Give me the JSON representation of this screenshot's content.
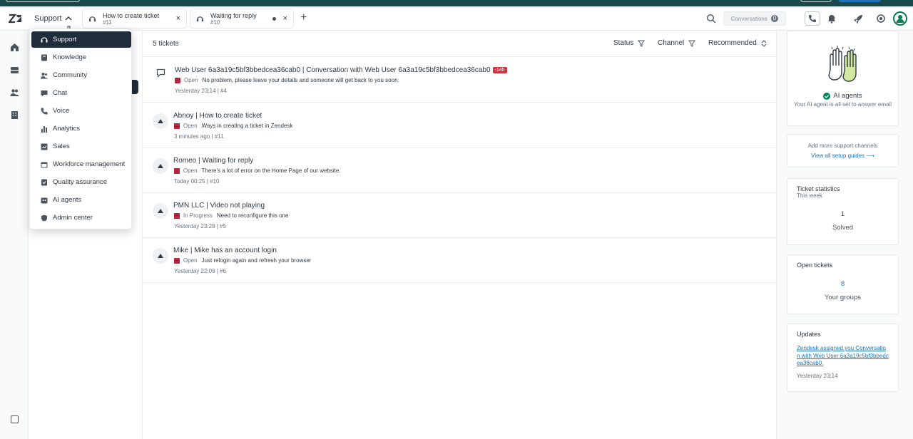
{
  "header": {
    "product_switcher_label": "Support",
    "tabs": [
      {
        "title": "How to create ticket",
        "subtitle": "#11"
      },
      {
        "title": "Waiting for reply",
        "subtitle": "#10"
      }
    ],
    "conversations_label": "Conversations",
    "conversations_count": "0"
  },
  "product_menu": {
    "items": [
      {
        "label": "Support",
        "icon": "headset-icon"
      },
      {
        "label": "Knowledge",
        "icon": "book-icon"
      },
      {
        "label": "Community",
        "icon": "people-icon"
      },
      {
        "label": "Chat",
        "icon": "chat-icon"
      },
      {
        "label": "Voice",
        "icon": "phone-icon"
      },
      {
        "label": "Analytics",
        "icon": "bar-chart-icon"
      },
      {
        "label": "Sales",
        "icon": "line-chart-icon"
      },
      {
        "label": "Workforce management",
        "icon": "calendar-icon"
      },
      {
        "label": "Quality assurance",
        "icon": "check-clipboard-icon"
      },
      {
        "label": "AI agents",
        "icon": "robot-icon"
      },
      {
        "label": "Admin center",
        "icon": "shield-icon"
      }
    ]
  },
  "list": {
    "count_label": "5 tickets",
    "filters": {
      "status": "Status",
      "channel": "Channel",
      "sort": "Recommended"
    },
    "tickets": [
      {
        "title": "Web User 6a3a19c5bf3bbedcea36cab0 | Conversation with Web User 6a3a19c5bf3bbedcea36cab0",
        "badge": "-14h",
        "status": "Open",
        "preview": "No problem, please leave your details and someone will get back to you soon.",
        "meta": "Yesterday 23:14 | #4"
      },
      {
        "title": "Abnoy | How to create ticket",
        "badge": "",
        "status": "Open",
        "preview": "Ways in creating a ticket in Zendesk",
        "meta": "3 minutes ago | #11"
      },
      {
        "title": "Romeo | Waiting for reply",
        "badge": "",
        "status": "Open",
        "preview": "There's a lot of error on the Home Page of our website.",
        "meta": "Today 00:25 | #10"
      },
      {
        "title": "PMN LLC | Video not playing",
        "badge": "",
        "status": "In Progress",
        "preview": "Need to reconfigure this one",
        "meta": "Yesterday 23:28 | #5"
      },
      {
        "title": "Mike | Mike has an account login",
        "badge": "",
        "status": "Open",
        "preview": "Just relogin again and refresh your browser",
        "meta": "Yesterday 22:09 | #6"
      }
    ]
  },
  "right": {
    "ai_card": {
      "title": "AI agents",
      "text": "Your AI agent is all set to answer email"
    },
    "channels_card": {
      "title": "Add more support channels",
      "link": "View all setup guides"
    },
    "stats_card": {
      "title": "Ticket statistics",
      "period": "This week",
      "value": "1",
      "value_label": "Solved"
    },
    "open_card": {
      "title": "Open tickets",
      "value": "8",
      "value_label": "Your groups"
    },
    "updates_card": {
      "title": "Updates",
      "link": "Zendesk assigned you Conversation with Web User 6a3a19c5bf3bbedcea36cab0.",
      "time": "Yesterday 23:14"
    }
  },
  "colors": {
    "status_open": "#b3243d",
    "accent_green": "#038153",
    "menu_active": "#1f2d3d"
  }
}
